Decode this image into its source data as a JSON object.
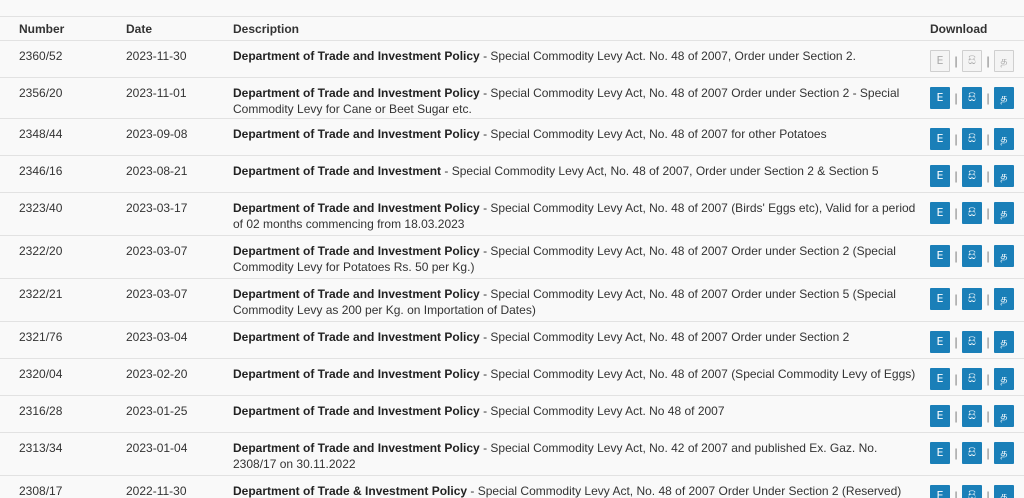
{
  "header": {
    "number": "Number",
    "date": "Date",
    "description": "Description",
    "download": "Download"
  },
  "download_labels": {
    "english": "E",
    "sinhala": "සි",
    "tamil": "த",
    "separator": "|"
  },
  "rows": [
    {
      "number": "2360/52",
      "date": "2023-11-30",
      "org": "Department of Trade and Investment Policy",
      "text": " - Special Commodity Levy Act. No. 48 of 2007, Order under Section 2.",
      "disabled": true,
      "h": 36
    },
    {
      "number": "2356/20",
      "date": "2023-11-01",
      "org": "Department of Trade and Investment Policy",
      "text": " - Special Commodity Levy Act, No. 48 of 2007 Order under Section 2 - Special Commodity Levy for Cane or Beet Sugar etc.",
      "disabled": false,
      "h": 40
    },
    {
      "number": "2348/44",
      "date": "2023-09-08",
      "org": "Department of Trade and Investment Policy",
      "text": " - Special Commodity Levy Act, No. 48 of 2007 for other Potatoes",
      "disabled": false,
      "h": 36
    },
    {
      "number": "2346/16",
      "date": "2023-08-21",
      "org": "Department of Trade and Investment",
      "text": " - Special Commodity Levy Act, No. 48 of 2007, Order under Section 2 & Section 5",
      "disabled": false,
      "h": 36
    },
    {
      "number": "2323/40",
      "date": "2023-03-17",
      "org": "Department of Trade and Investment Policy",
      "text": " - Special Commodity Levy Act, No. 48 of 2007 (Birds' Eggs etc), Valid for a period of 02 months commencing from 18.03.2023",
      "disabled": false,
      "h": 42
    },
    {
      "number": "2322/20",
      "date": "2023-03-07",
      "org": "Department of Trade and Investment Policy",
      "text": " - Special Commodity Levy Act, No. 48 of 2007 Order under Section 2 (Special Commodity Levy for Potatoes Rs. 50 per Kg.)",
      "disabled": false,
      "h": 42
    },
    {
      "number": "2322/21",
      "date": "2023-03-07",
      "org": "Department of Trade and Investment Policy",
      "text": " - Special Commodity Levy Act, No. 48 of 2007 Order under Section 5 (Special Commodity Levy as 200 per Kg. on Importation of Dates)",
      "disabled": false,
      "h": 42
    },
    {
      "number": "2321/76",
      "date": "2023-03-04",
      "org": "Department of Trade and Investment Policy",
      "text": " - Special Commodity Levy Act, No. 48 of 2007 Order under Section 2",
      "disabled": false,
      "h": 36
    },
    {
      "number": "2320/04",
      "date": "2023-02-20",
      "org": "Department of Trade and Investment Policy",
      "text": " - Special Commodity Levy Act, No. 48 of 2007 (Special Commodity Levy of Eggs)",
      "disabled": false,
      "h": 36
    },
    {
      "number": "2316/28",
      "date": "2023-01-25",
      "org": "Department of Trade and Investment Policy",
      "text": " - Special Commodity Levy Act. No 48 of 2007",
      "disabled": false,
      "h": 36
    },
    {
      "number": "2313/34",
      "date": "2023-01-04",
      "org": "Department of Trade and Investment Policy",
      "text": " - Special Commodity Levy Act, No. 42 of 2007 and published Ex. Gaz. No. 2308/17 on 30.11.2022",
      "disabled": false,
      "h": 42
    },
    {
      "number": "2308/17",
      "date": "2022-11-30",
      "org": "Department of Trade & Investment Policy",
      "text": " - Special Commodity Levy Act, No. 48 of 2007 Order Under Section 2 (Reserved)",
      "disabled": false,
      "h": 40
    }
  ]
}
